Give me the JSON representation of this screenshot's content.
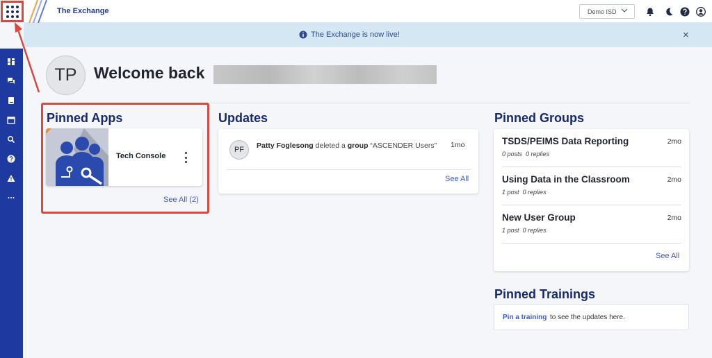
{
  "header": {
    "brand": "The Exchange",
    "district": "Demo ISD"
  },
  "banner": {
    "message": "The Exchange is now live!",
    "close": "×"
  },
  "sidebar": {
    "items": [
      "dashboard-icon",
      "chat-icon",
      "book-icon",
      "calendar-icon",
      "search-icon",
      "help-icon",
      "warning-icon",
      "more-icon"
    ]
  },
  "welcome": {
    "initials": "TP",
    "greeting": "Welcome back"
  },
  "pinned_apps": {
    "title": "Pinned Apps",
    "apps": [
      {
        "name": "Tech Console"
      }
    ],
    "see_all": "See All (2)"
  },
  "updates": {
    "title": "Updates",
    "items": [
      {
        "initials": "PF",
        "actor": "Patty Foglesong",
        "action": "deleted a",
        "object_type": "group",
        "object_name": "“ASCENDER Users”",
        "time": "1mo"
      }
    ],
    "see_all": "See All"
  },
  "pinned_groups": {
    "title": "Pinned Groups",
    "groups": [
      {
        "name": "TSDS/PEIMS Data Reporting",
        "posts": "0 posts",
        "replies": "0 replies",
        "time": "2mo"
      },
      {
        "name": "Using Data in the Classroom",
        "posts": "1 post",
        "replies": "0 replies",
        "time": "2mo"
      },
      {
        "name": "New User Group",
        "posts": "1 post",
        "replies": "0 replies",
        "time": "2mo"
      }
    ],
    "see_all": "See All"
  },
  "pinned_trainings": {
    "title": "Pinned Trainings",
    "link": "Pin a training",
    "text": "to see the updates here."
  },
  "colors": {
    "sidebar": "#1e3aa0",
    "accent": "#3b5bcc",
    "highlight": "#d9473f",
    "banner": "#d5e7f3",
    "heading": "#172a6e"
  }
}
